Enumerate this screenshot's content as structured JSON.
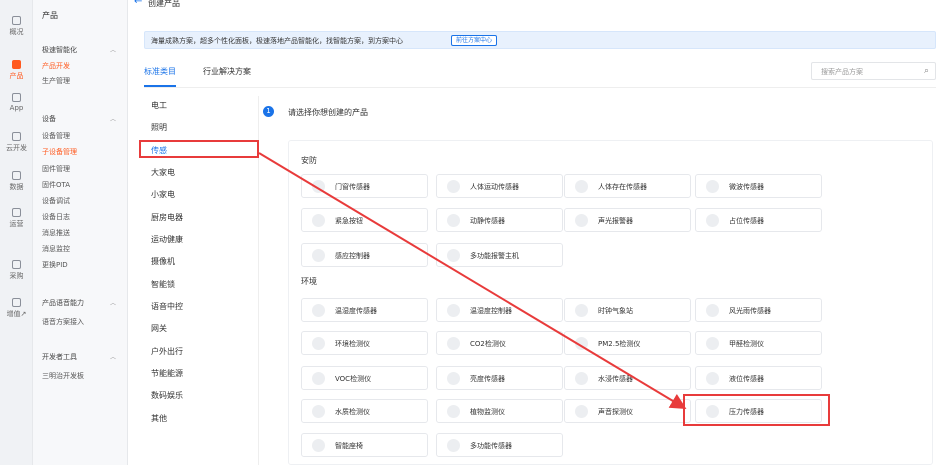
{
  "rail": [
    {
      "label": "概况",
      "icon": "home-icon"
    },
    {
      "label": "产品",
      "icon": "product-icon",
      "active": true
    },
    {
      "label": "App",
      "icon": "phone-icon"
    },
    {
      "label": "云开发",
      "icon": "cloud-icon"
    },
    {
      "label": "数据",
      "icon": "chart-icon"
    },
    {
      "label": "运营",
      "icon": "operation-icon"
    },
    {
      "label": "采购",
      "icon": "cart-icon"
    },
    {
      "label": "增值↗",
      "icon": "diamond-icon"
    }
  ],
  "nav": {
    "title": "产品",
    "sections": [
      {
        "label": "极速智能化",
        "items": [
          "产品开发",
          "生产管理"
        ]
      },
      {
        "label": "设备",
        "items": [
          "设备管理",
          "子设备管理",
          "固件管理",
          "固件OTA",
          "设备调试",
          "设备日志",
          "消息推送",
          "消息监控",
          "更换PID"
        ]
      },
      {
        "label": "产品语音能力",
        "items": [
          "语音方案接入"
        ]
      },
      {
        "label": "开发者工具",
        "items": [
          "三明治开发板"
        ]
      }
    ],
    "active_item": "产品开发"
  },
  "header": {
    "back": "←",
    "title": "创建产品"
  },
  "banner": {
    "text": "海量成熟方案，超多个性化面板，极速落地产品智能化，找智能方案，到方案中心",
    "button": "前往方案中心"
  },
  "tabs": [
    {
      "label": "标准类目",
      "active": true
    },
    {
      "label": "行业解决方案",
      "active": false
    }
  ],
  "search": {
    "placeholder": "搜索产品方案"
  },
  "categories": [
    "电工",
    "照明",
    "传感",
    "大家电",
    "小家电",
    "厨房电器",
    "运动健康",
    "摄像机",
    "智能锁",
    "语音中控",
    "网关",
    "户外出行",
    "节能能源",
    "数码娱乐",
    "其他"
  ],
  "active_category": "传感",
  "step": {
    "num": "1",
    "text": "请选择你想创建的产品"
  },
  "groups": [
    {
      "title": "安防",
      "items": [
        "门窗传感器",
        "人体运动传感器",
        "人体存在传感器",
        "微波传感器",
        "紧急按钮",
        "动静传感器",
        "声光报警器",
        "占位传感器",
        "感应控制器",
        "多功能报警主机"
      ]
    },
    {
      "title": "环境",
      "items": [
        "温湿度传感器",
        "温湿度控制器",
        "时钟气象站",
        "风光雨传感器",
        "环境检测仪",
        "CO2检测仪",
        "PM2.5检测仪",
        "甲醛检测仪",
        "VOC检测仪",
        "亮度传感器",
        "水浸传感器",
        "液位传感器",
        "水质检测仪",
        "植物监测仪",
        "声音探测仪",
        "压力传感器",
        "智能座椅",
        "多功能传感器"
      ]
    }
  ],
  "colors": {
    "accent": "#1a73e8",
    "brand": "#ff5a1f",
    "annotation": "#e83b3b"
  }
}
